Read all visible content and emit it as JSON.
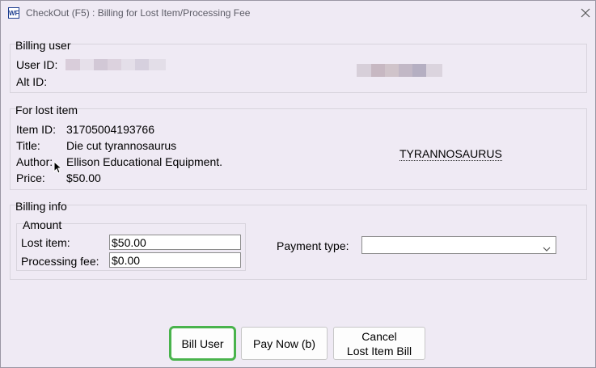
{
  "window": {
    "app_icon": "WF",
    "title": "CheckOut (F5) : Billing for Lost Item/Processing Fee",
    "close_icon": "close-icon"
  },
  "billing_user": {
    "legend": "Billing user",
    "user_id_label": "User ID:",
    "alt_id_label": "Alt ID:"
  },
  "lost_item": {
    "legend": "For lost item",
    "item_id_label": "Item ID:",
    "item_id_value": "31705004193766",
    "title_label": "Title:",
    "title_value": "Die cut tyrannosaurus",
    "author_label": "Author:",
    "author_value": "Ellison Educational Equipment.",
    "price_label": "Price:",
    "price_value": "$50.00",
    "link_text": "TYRANNOSAURUS"
  },
  "billing_info": {
    "legend": "Billing info",
    "amount_legend": "Amount",
    "lost_item_label": "Lost item:",
    "lost_item_value": "$50.00",
    "processing_fee_label": "Processing fee:",
    "processing_fee_value": "$0.00",
    "payment_type_label": "Payment type:",
    "payment_type_value": ""
  },
  "buttons": {
    "bill_user": "Bill User",
    "pay_now": "Pay Now (b)",
    "cancel_line1": "Cancel",
    "cancel_line2": "Lost Item Bill"
  },
  "colors": {
    "background": "#efeaf4",
    "focus_ring": "#49b34c",
    "app_icon_blue": "#1c3d8f"
  }
}
